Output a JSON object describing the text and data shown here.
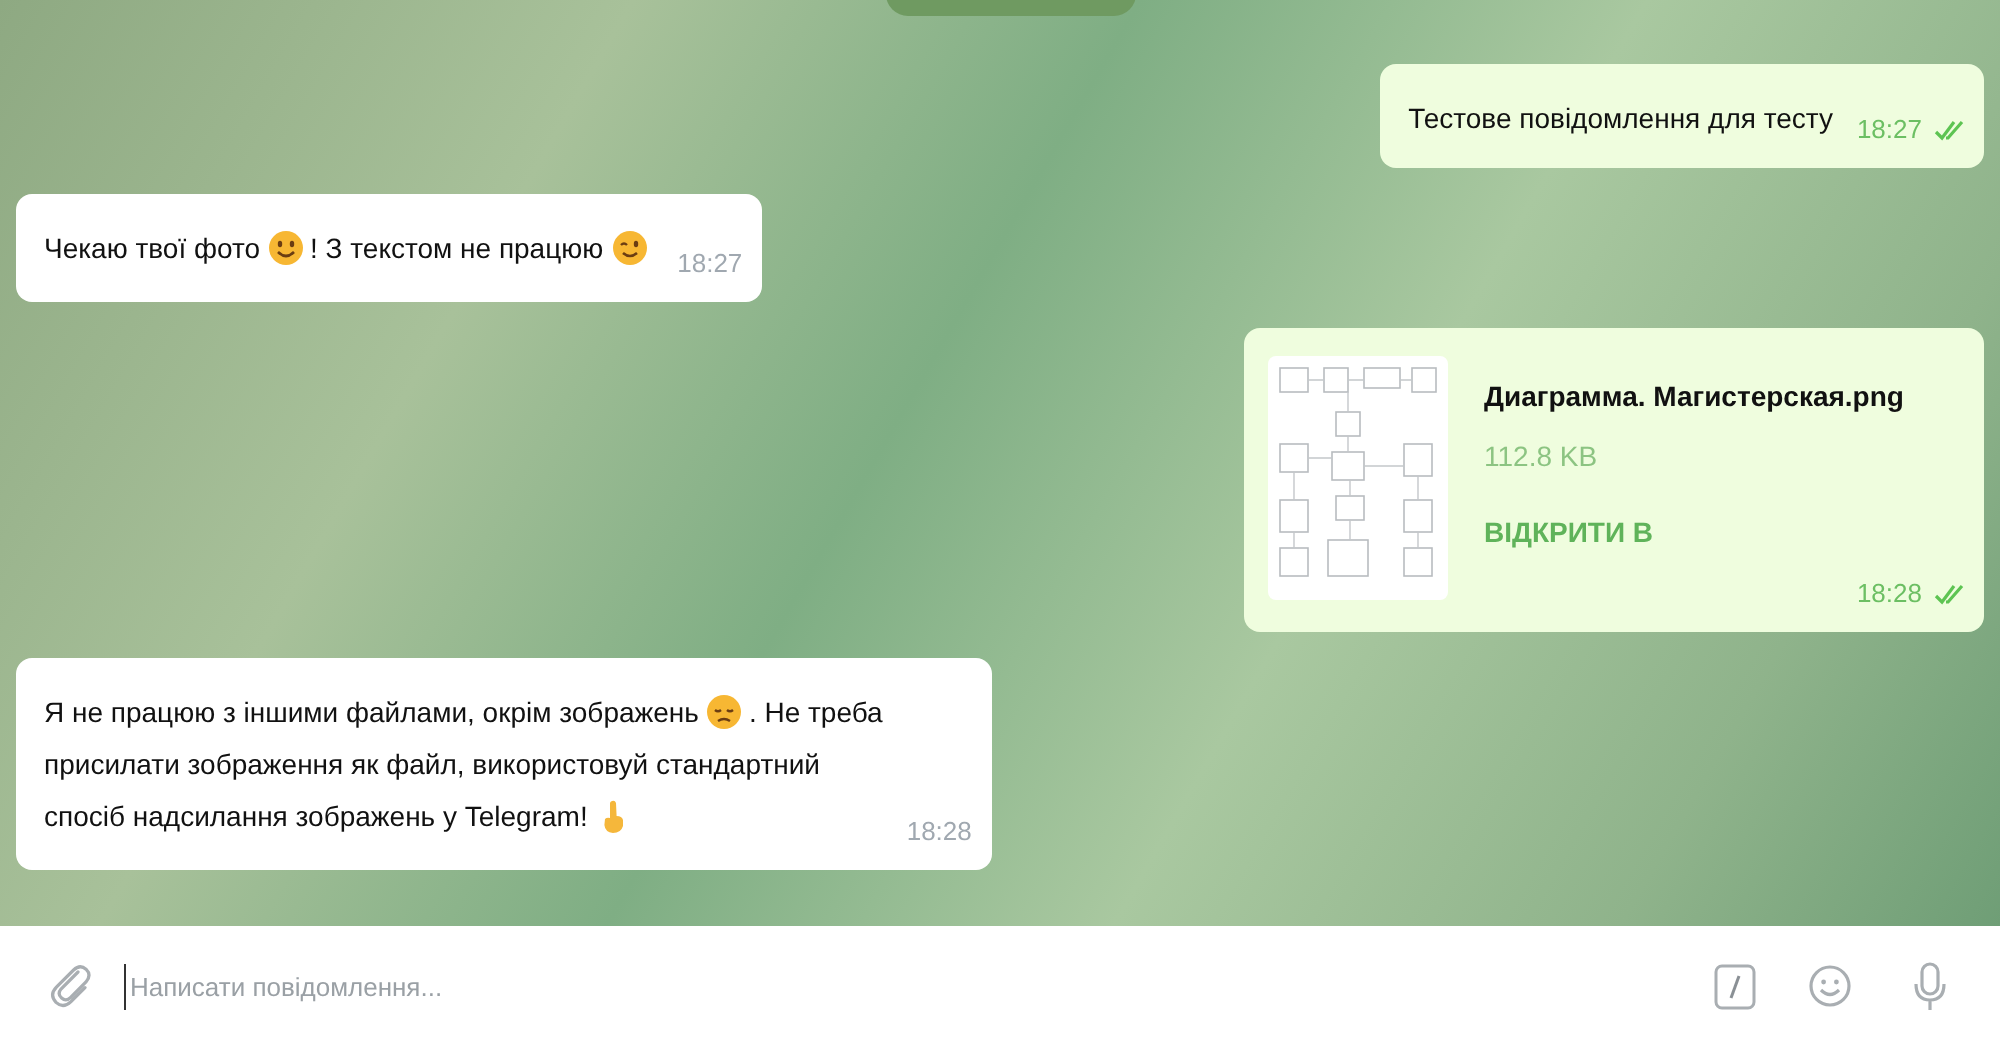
{
  "messages": [
    {
      "kind": "text",
      "outgoing": true,
      "lines": [
        [
          {
            "kind": "text",
            "text": "Тестове повідомлення для тесту"
          }
        ]
      ],
      "time": "18:27",
      "read": true
    },
    {
      "kind": "text",
      "outgoing": false,
      "lines": [
        [
          {
            "kind": "text",
            "text": "Чекаю твої фото"
          },
          {
            "kind": "smile"
          },
          {
            "kind": "text",
            "text": "! З текстом не працюю"
          },
          {
            "kind": "wink"
          }
        ]
      ],
      "time": "18:27"
    },
    {
      "kind": "file",
      "outgoing": true,
      "name": "Диаграмма. Магистерская.png",
      "size": "112.8 KB",
      "action": "ВІДКРИТИ В",
      "time": "18:28",
      "read": true
    },
    {
      "kind": "text",
      "outgoing": false,
      "lines": [
        [
          {
            "kind": "text",
            "text": "Я не працюю з іншими файлами, окрім зображень"
          },
          {
            "kind": "sad"
          },
          {
            "kind": "text",
            "text": ". Не треба"
          }
        ],
        [
          {
            "kind": "text",
            "text": "присилати зображення як файл, використовуй стандартний"
          }
        ],
        [
          {
            "kind": "text",
            "text": "спосіб надсилання зображень у Telegram!"
          },
          {
            "kind": "point"
          }
        ]
      ],
      "time": "18:28"
    }
  ],
  "composer": {
    "placeholder": "Написати повідомлення..."
  }
}
